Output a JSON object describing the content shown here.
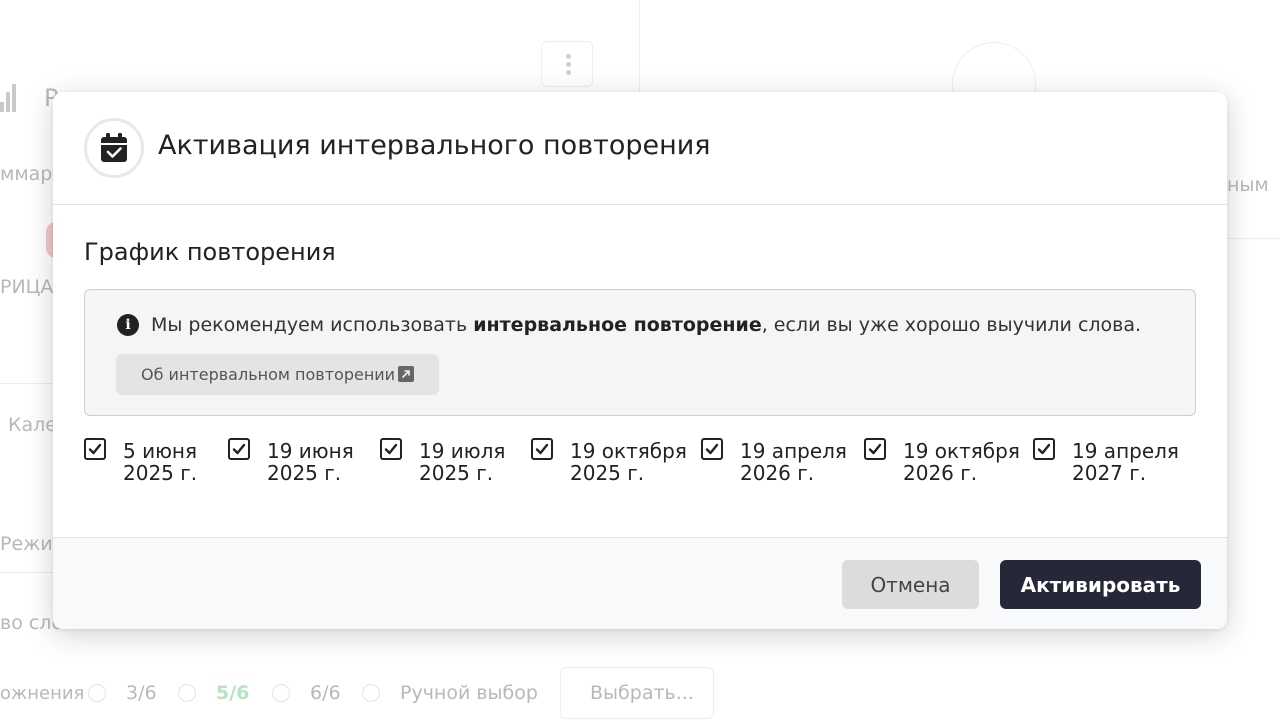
{
  "background": {
    "texts": [
      "Р",
      "ммар",
      "РИЦА",
      "Кале",
      "Режим",
      "ным",
      "во сло",
      "ожнения",
      "3/6",
      "5/6",
      "6/6",
      "Ручной выбор",
      "Выбрать..."
    ]
  },
  "modal": {
    "title": "Активация интервального повторения",
    "header_icon": "calendar-check-icon",
    "section_title": "График повторения",
    "info": {
      "icon": "info-icon",
      "text_before": "Мы рекомендуем использовать ",
      "text_bold": "интервальное повторение",
      "text_after": ", если вы уже хорошо выучили слова.",
      "link_label": "Об интервальном повторении",
      "link_icon": "external-link-icon"
    },
    "dates": [
      {
        "line1": "5 июня",
        "line2": "2025 г.",
        "checked": true
      },
      {
        "line1": "19 июня",
        "line2": "2025 г.",
        "checked": true
      },
      {
        "line1": "19 июля",
        "line2": "2025 г.",
        "checked": true
      },
      {
        "line1": "19 октября",
        "line2": "2025 г.",
        "checked": true
      },
      {
        "line1": "19 апреля",
        "line2": "2026 г.",
        "checked": true
      },
      {
        "line1": "19 октября",
        "line2": "2026 г.",
        "checked": true
      },
      {
        "line1": "19 апреля",
        "line2": "2027 г.",
        "checked": true
      }
    ],
    "cancel_label": "Отмена",
    "activate_label": "Активировать"
  },
  "colors": {
    "primary_button": "#26283a",
    "secondary_button": "#dcdcde",
    "accent_green": "#7ccf8b"
  }
}
